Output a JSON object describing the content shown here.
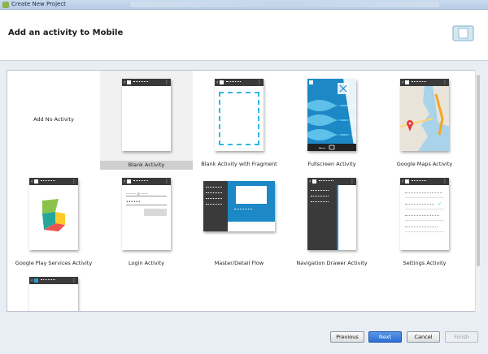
{
  "window": {
    "title": "Create New Project"
  },
  "header": {
    "title": "Add an activity to Mobile",
    "device_icon": "tablet-device-icon"
  },
  "gallery": {
    "items": [
      {
        "label": "Add No Activity"
      },
      {
        "label": "Blank Activity",
        "selected": true
      },
      {
        "label": "Blank Activity with Fragment"
      },
      {
        "label": "Fullscreen Activity"
      },
      {
        "label": "Google Maps Activity"
      },
      {
        "label": "Google Play Services Activity"
      },
      {
        "label": "Login Activity"
      },
      {
        "label": "Master/Detail Flow"
      },
      {
        "label": "Navigation Drawer Activity"
      },
      {
        "label": "Settings Activity"
      },
      {
        "label": ""
      }
    ]
  },
  "footer": {
    "previous_label": "Previous",
    "next_label": "Next",
    "cancel_label": "Cancel",
    "finish_label": "Finish"
  },
  "colors": {
    "accent": "#2c6fd3",
    "android_blue": "#33b5e5",
    "phone_bar": "#3a3a3a"
  }
}
